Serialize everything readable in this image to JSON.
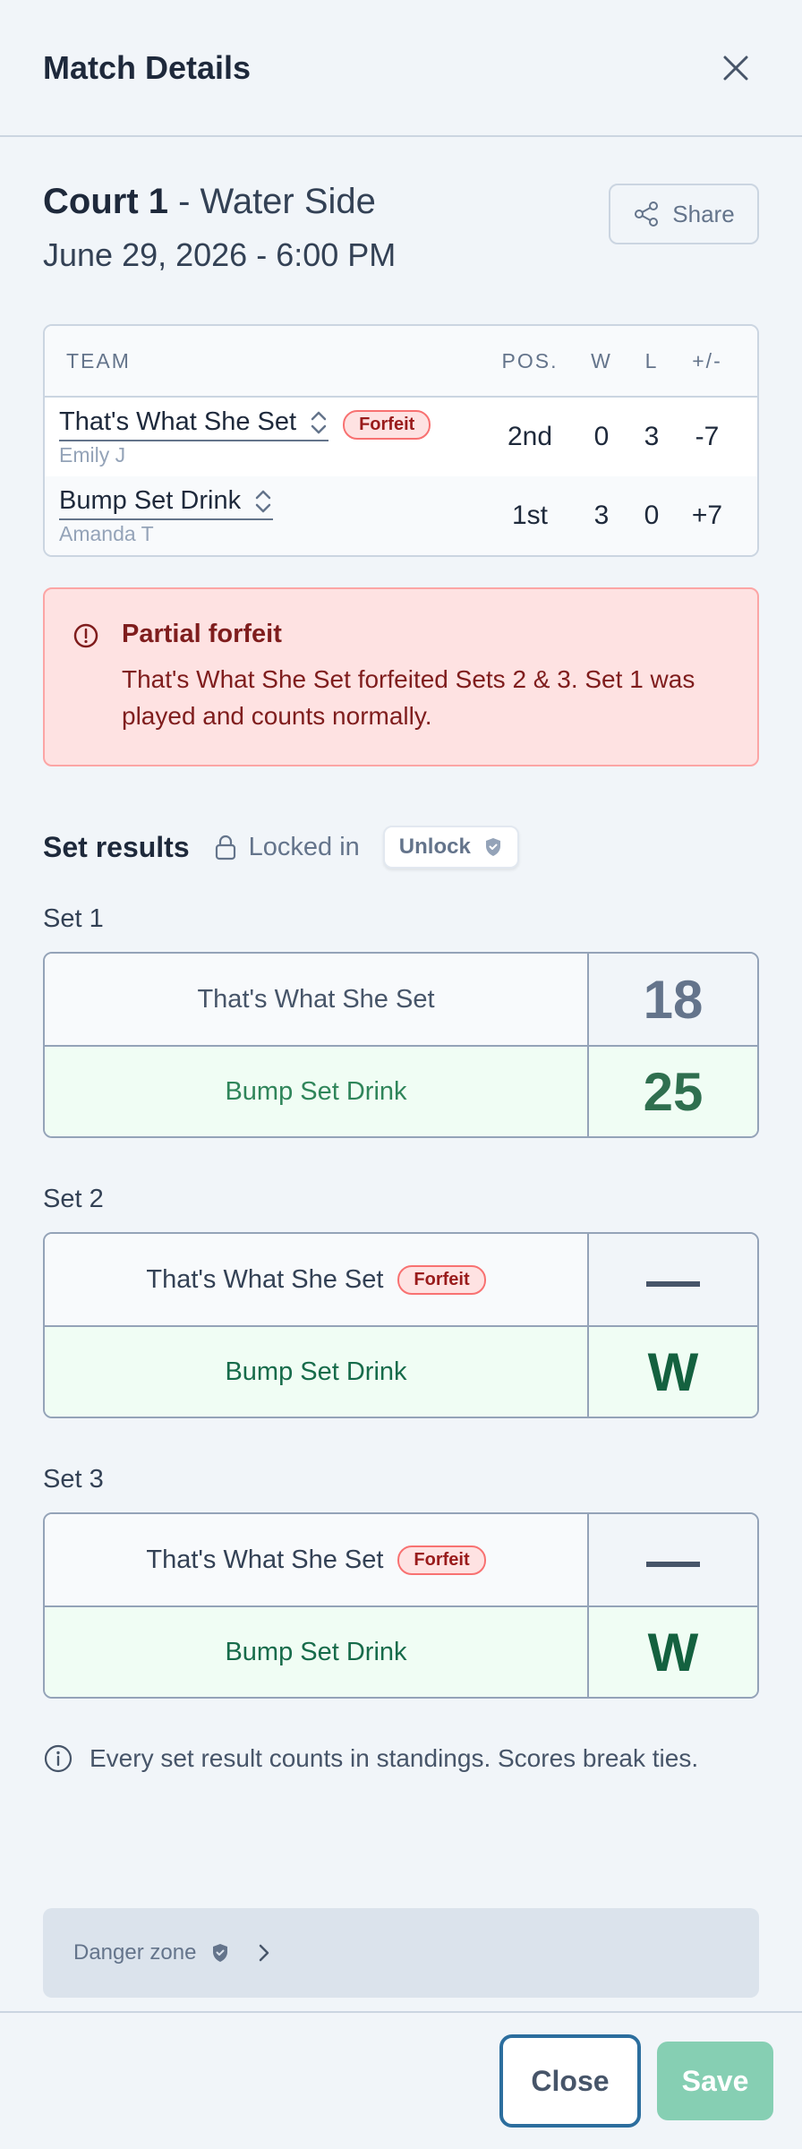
{
  "header": {
    "title": "Match Details"
  },
  "match": {
    "court": "Court 1",
    "location": " - Water Side",
    "datetime": "June 29, 2026 - 6:00 PM",
    "share_label": "Share"
  },
  "standings": {
    "headers": {
      "team": "TEAM",
      "pos": "POS.",
      "w": "W",
      "l": "L",
      "pm": "+/-"
    },
    "rows": [
      {
        "team": "That's What She Set",
        "captain": "Emily J",
        "badge": "Forfeit",
        "pos": "2nd",
        "w": "0",
        "l": "3",
        "pm": "-7"
      },
      {
        "team": "Bump Set Drink",
        "captain": "Amanda T",
        "pos": "1st",
        "w": "3",
        "l": "0",
        "pm": "+7"
      }
    ]
  },
  "alert": {
    "title": "Partial forfeit",
    "body": "That's What She Set forfeited Sets 2 & 3. Set 1 was played and counts normally."
  },
  "results": {
    "title": "Set results",
    "locked_label": "Locked in",
    "unlock_label": "Unlock"
  },
  "sets": [
    {
      "label": "Set 1",
      "rows": [
        {
          "team": "That's What She Set",
          "score": "18"
        },
        {
          "team": "Bump Set Drink",
          "score": "25"
        }
      ]
    },
    {
      "label": "Set 2",
      "rows": [
        {
          "team": "That's What She Set",
          "badge": "Forfeit",
          "score": "—"
        },
        {
          "team": "Bump Set Drink",
          "score": "W"
        }
      ]
    },
    {
      "label": "Set 3",
      "rows": [
        {
          "team": "That's What She Set",
          "badge": "Forfeit",
          "score": "—"
        },
        {
          "team": "Bump Set Drink",
          "score": "W"
        }
      ]
    }
  ],
  "note": "Every set result counts in standings. Scores break ties.",
  "danger": {
    "label": "Danger zone"
  },
  "footer": {
    "close_label": "Close",
    "save_label": "Save"
  },
  "colors": {
    "accent": "#2c6e9e",
    "save": "#86cfb3",
    "danger_bg": "#fee2e2",
    "win": "#2f6f4f"
  },
  "icons": [
    "close-icon",
    "share-icon",
    "chevron-updown-icon",
    "alert-circle-icon",
    "lock-icon",
    "shield-icon",
    "info-icon",
    "chevron-right-icon"
  ]
}
